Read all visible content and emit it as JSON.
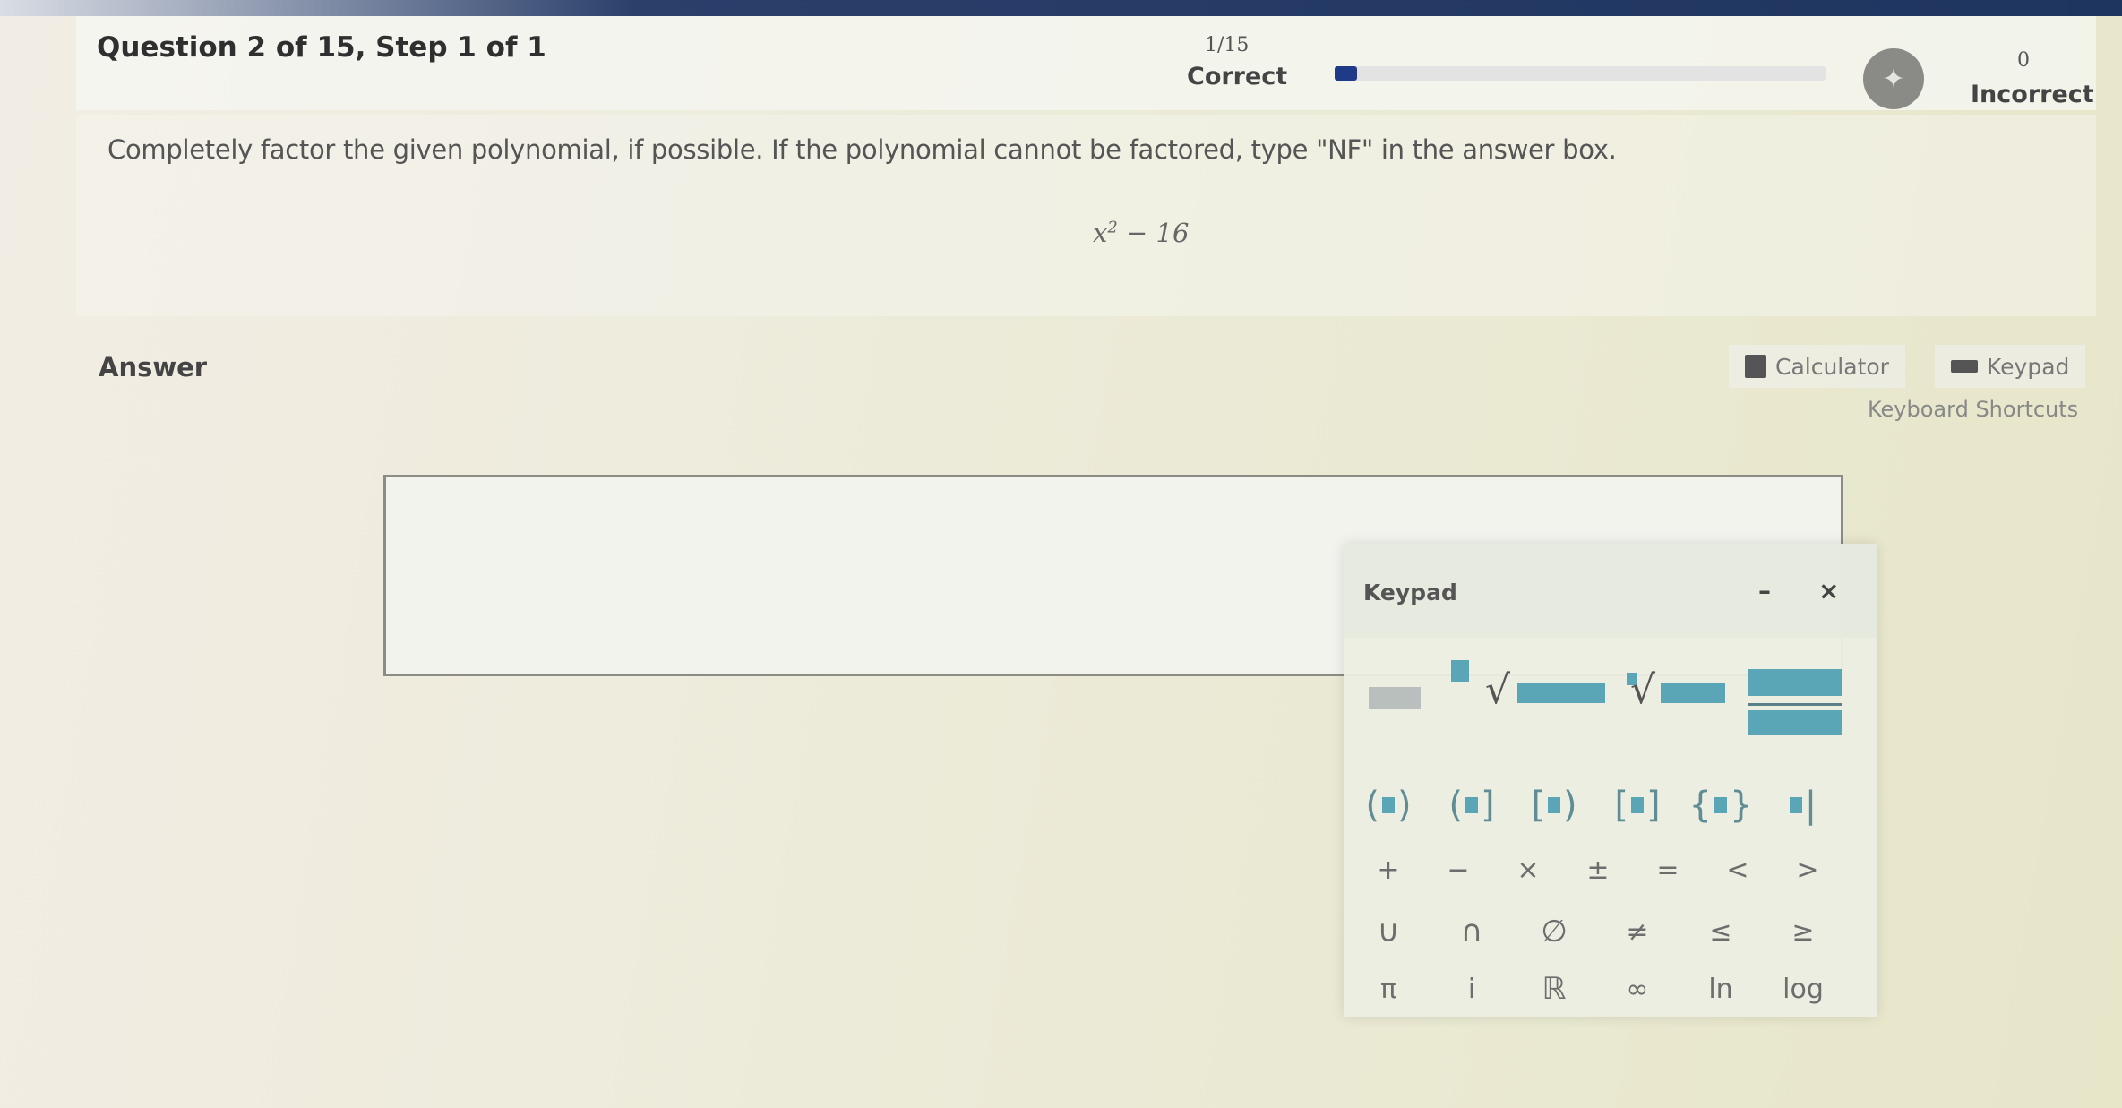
{
  "header": {
    "question_title": "Question 2 of 15, Step 1 of 1",
    "correct_count": "1/15",
    "correct_label": "Correct",
    "progress_fraction": 0.045,
    "incorrect_count": "0",
    "incorrect_label": "Incorrect",
    "streak_icon": "flame-icon"
  },
  "prompt": {
    "instructions": "Completely factor the given polynomial, if possible. If the polynomial cannot be factored, type \"NF\" in the answer box.",
    "expression_base": "x",
    "expression_exp": "2",
    "expression_rest": " − 16"
  },
  "answer": {
    "label": "Answer",
    "value": ""
  },
  "tools": {
    "calculator_label": "Calculator",
    "keypad_label": "Keypad",
    "shortcuts_label": "Keyboard Shortcuts"
  },
  "keypad": {
    "title": "Keypad",
    "minimize": "–",
    "close": "×",
    "row_brackets": [
      "( )",
      "( ]",
      "[ )",
      "[ ]",
      "{ }",
      "| |"
    ],
    "row_ops": [
      "+",
      "−",
      "×",
      "±",
      "=",
      "<",
      ">"
    ],
    "row_sets": [
      "∪",
      "∩",
      "∅",
      "≠",
      "≤",
      "≥"
    ],
    "row_misc": [
      "π",
      "i",
      "ℝ",
      "∞",
      "ln",
      "log"
    ]
  },
  "colors": {
    "accent": "#1f3a86",
    "keypad_key": "#5aa6b6"
  }
}
